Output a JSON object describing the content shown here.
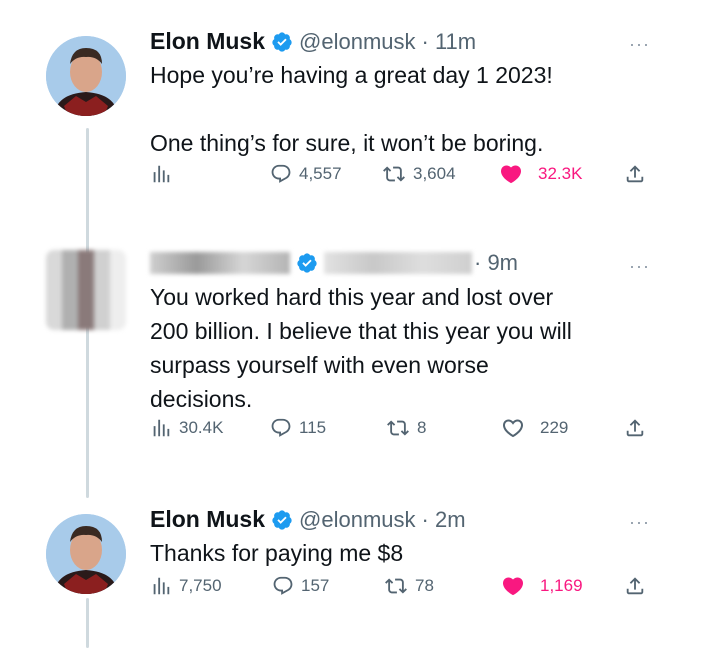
{
  "tweets": [
    {
      "name": "Elon Musk",
      "handle": "@elonmusk",
      "time": "· 11m",
      "text": "Hope you’re having a great day 1 2023!\n\nOne thing’s for sure, it won’t be boring.",
      "views": "",
      "replies": "4,557",
      "retweets": "3,604",
      "likes": "32.3K",
      "liked": true,
      "more": "···"
    },
    {
      "name": "",
      "handle": "",
      "time": "· 9m",
      "text": "You worked hard this year and lost over\n200 billion. I believe that this year you will\nsurpass yourself with even worse\ndecisions.",
      "views": "30.4K",
      "replies": "115",
      "retweets": "8",
      "likes": "229",
      "liked": false,
      "more": "···"
    },
    {
      "name": "Elon Musk",
      "handle": "@elonmusk",
      "time": "· 2m",
      "text": "Thanks for paying me $8",
      "views": "7,750",
      "replies": "157",
      "retweets": "78",
      "likes": "1,169",
      "liked": true,
      "more": "···"
    }
  ],
  "icons": {
    "views": "views-icon",
    "reply": "reply-icon",
    "retweet": "retweet-icon",
    "like": "heart-icon",
    "share": "share-icon",
    "verified": "verified-badge-icon"
  },
  "colors": {
    "verified": "#1d9bf0",
    "like": "#f91880",
    "muted": "#536471",
    "thread_line": "#cfd9de"
  }
}
